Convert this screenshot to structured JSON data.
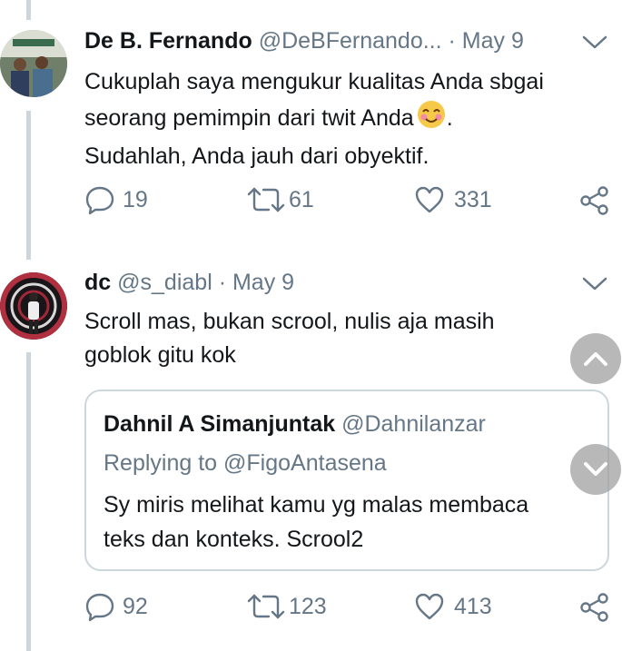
{
  "tweets": [
    {
      "name": "De B. Fernando",
      "handle": "@DeBFernando...",
      "date": "· May 9",
      "lines": [
        "Cukuplah saya mengukur kualitas Anda sbgai",
        "seorang pemimpin dari twit Anda",
        ".",
        "Sudahlah, Anda jauh dari obyektif."
      ],
      "replies": "19",
      "retweets": "61",
      "likes": "331"
    },
    {
      "name": "dc",
      "handle": "@s_diabl",
      "date": "· May 9",
      "lines": [
        "Scroll mas, bukan scrool, nulis aja masih",
        "goblok gitu kok"
      ],
      "quoted": {
        "name": "Dahnil A Simanjuntak",
        "handle": "@Dahnilanzar",
        "replying_prefix": "Replying to",
        "replying_to": "@FigoAntasena",
        "lines": [
          "Sy miris melihat kamu yg malas membaca",
          "teks dan konteks. Scrool2"
        ]
      },
      "replies": "92",
      "retweets": "123",
      "likes": "413"
    }
  ],
  "icons": {
    "reply": "reply-icon",
    "retweet": "retweet-icon",
    "like": "heart-icon",
    "share": "share-icon",
    "menu": "chevron-down-icon",
    "emoji": "smiling-face-emoji",
    "scroll_up": "chevron-up-icon",
    "scroll_down": "chevron-down-icon"
  },
  "colors": {
    "text": "#14171a",
    "muted": "#657786",
    "line": "#ccd6dd",
    "accent": "#1da1f2"
  }
}
